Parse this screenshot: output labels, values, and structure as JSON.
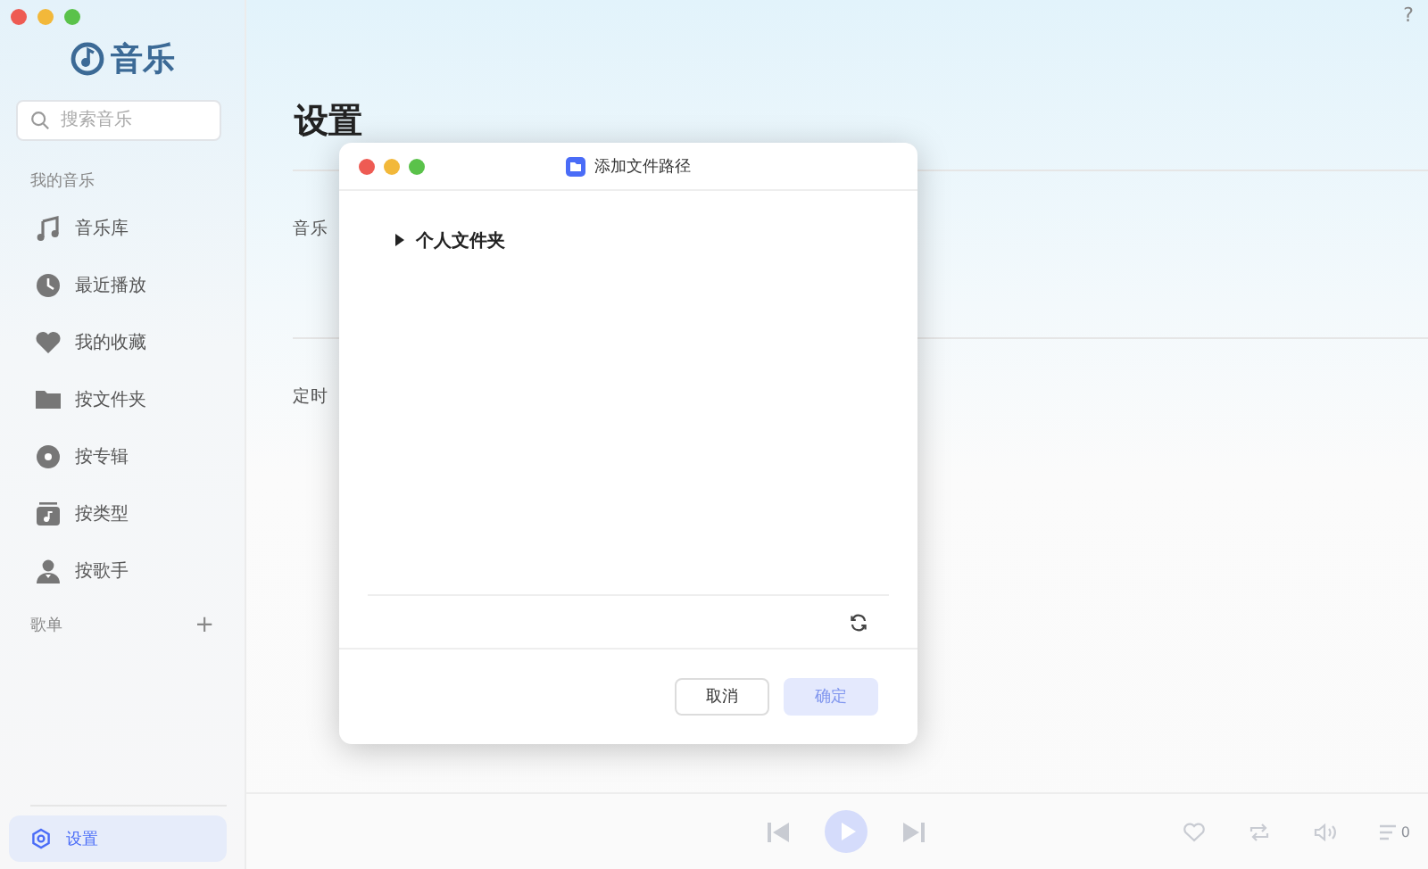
{
  "app": {
    "name": "音乐"
  },
  "search": {
    "placeholder": "搜索音乐"
  },
  "sidebar": {
    "section": "我的音乐",
    "items": [
      {
        "label": "音乐库",
        "selected": false
      },
      {
        "label": "最近播放",
        "selected": false
      },
      {
        "label": "我的收藏",
        "selected": false
      },
      {
        "label": "按文件夹",
        "selected": false
      },
      {
        "label": "按专辑",
        "selected": false
      },
      {
        "label": "按类型",
        "selected": false
      },
      {
        "label": "按歌手",
        "selected": false
      }
    ],
    "playlists": {
      "label": "歌单",
      "add": "+"
    },
    "settings": {
      "label": "设置",
      "selected": true
    }
  },
  "help": "?",
  "page": {
    "title": "设置",
    "sections": [
      {
        "label": "音乐"
      },
      {
        "label": "定时"
      }
    ]
  },
  "dialog": {
    "title": "添加文件路径",
    "tree": [
      {
        "label": "个人文件夹",
        "expanded": false
      }
    ],
    "buttons": [
      {
        "label": "取消",
        "kind": "secondary",
        "disabled": false
      },
      {
        "label": "确定",
        "kind": "primary",
        "disabled": true
      }
    ]
  },
  "player": {
    "queue_count": "0"
  }
}
